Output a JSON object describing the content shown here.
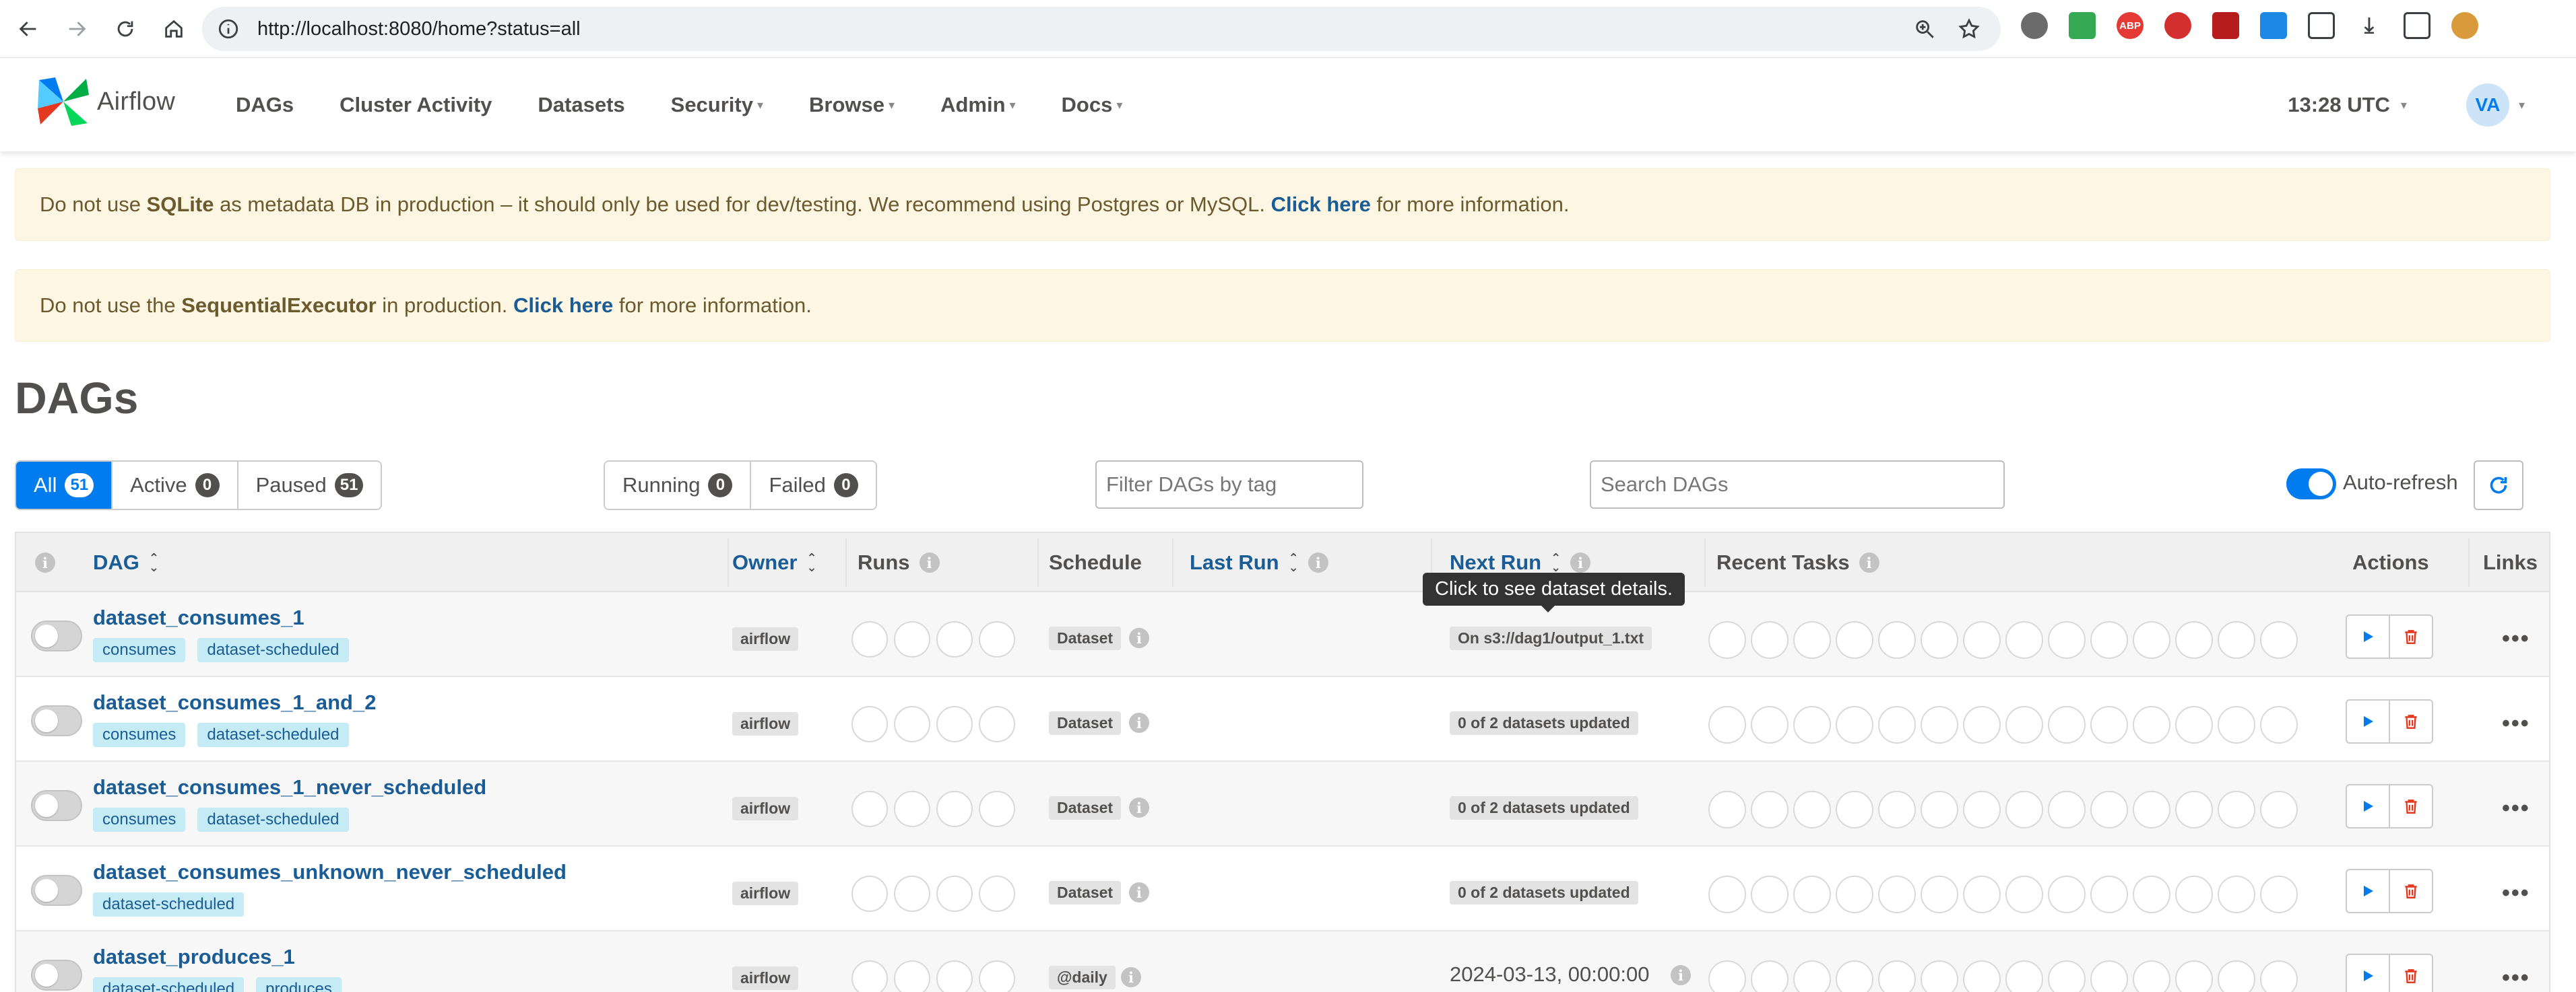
{
  "browser": {
    "url": "http://localhost:8080/home?status=all"
  },
  "navbar": {
    "brand": "Airflow",
    "menu": [
      {
        "label": "DAGs",
        "dropdown": false
      },
      {
        "label": "Cluster Activity",
        "dropdown": false
      },
      {
        "label": "Datasets",
        "dropdown": false
      },
      {
        "label": "Security",
        "dropdown": true
      },
      {
        "label": "Browse",
        "dropdown": true
      },
      {
        "label": "Admin",
        "dropdown": true
      },
      {
        "label": "Docs",
        "dropdown": true
      }
    ],
    "clock": "13:28 UTC",
    "avatar": "VA"
  },
  "alerts": {
    "sqlite": {
      "pre": "Do not use ",
      "strong": "SQLite",
      "mid": " as metadata DB in production – it should only be used for dev/testing. We recommend using Postgres or MySQL. ",
      "link": "Click here",
      "post": " for more information."
    },
    "executor": {
      "pre": "Do not use the ",
      "strong": "SequentialExecutor",
      "mid": " in production. ",
      "link": "Click here",
      "post": " for more information."
    }
  },
  "page": {
    "title": "DAGs"
  },
  "filters": {
    "status": [
      {
        "label": "All",
        "count": "51"
      },
      {
        "label": "Active",
        "count": "0"
      },
      {
        "label": "Paused",
        "count": "51"
      }
    ],
    "state": [
      {
        "label": "Running",
        "count": "0"
      },
      {
        "label": "Failed",
        "count": "0"
      }
    ],
    "tag_placeholder": "Filter DAGs by tag",
    "search_placeholder": "Search DAGs",
    "autorefresh_label": "Auto-refresh"
  },
  "table": {
    "headers": {
      "dag": "DAG",
      "owner": "Owner",
      "runs": "Runs",
      "schedule": "Schedule",
      "last_run": "Last Run",
      "next_run": "Next Run",
      "recent_tasks": "Recent Tasks",
      "actions": "Actions",
      "links": "Links"
    },
    "tooltip": "Click to see dataset details.",
    "rows": [
      {
        "name": "dataset_consumes_1",
        "tags": [
          "consumes",
          "dataset-scheduled"
        ],
        "owner": "airflow",
        "schedule": "Dataset",
        "next_run": "On s3://dag1/output_1.txt",
        "next_run_type": "pill"
      },
      {
        "name": "dataset_consumes_1_and_2",
        "tags": [
          "consumes",
          "dataset-scheduled"
        ],
        "owner": "airflow",
        "schedule": "Dataset",
        "next_run": "0 of 2 datasets updated",
        "next_run_type": "pill"
      },
      {
        "name": "dataset_consumes_1_never_scheduled",
        "tags": [
          "consumes",
          "dataset-scheduled"
        ],
        "owner": "airflow",
        "schedule": "Dataset",
        "next_run": "0 of 2 datasets updated",
        "next_run_type": "pill"
      },
      {
        "name": "dataset_consumes_unknown_never_scheduled",
        "tags": [
          "dataset-scheduled"
        ],
        "owner": "airflow",
        "schedule": "Dataset",
        "next_run": "0 of 2 datasets updated",
        "next_run_type": "pill"
      },
      {
        "name": "dataset_produces_1",
        "tags": [
          "dataset-scheduled",
          "produces"
        ],
        "owner": "airflow",
        "schedule": "@daily",
        "next_run": "2024-03-13, 00:00:00",
        "next_run_type": "text"
      }
    ]
  },
  "colors": {
    "accent": "#017cee",
    "link": "#1a5c96",
    "alert_bg": "#fdf6e3",
    "tag_bg": "#c5ecf4",
    "danger": "#e43921"
  }
}
